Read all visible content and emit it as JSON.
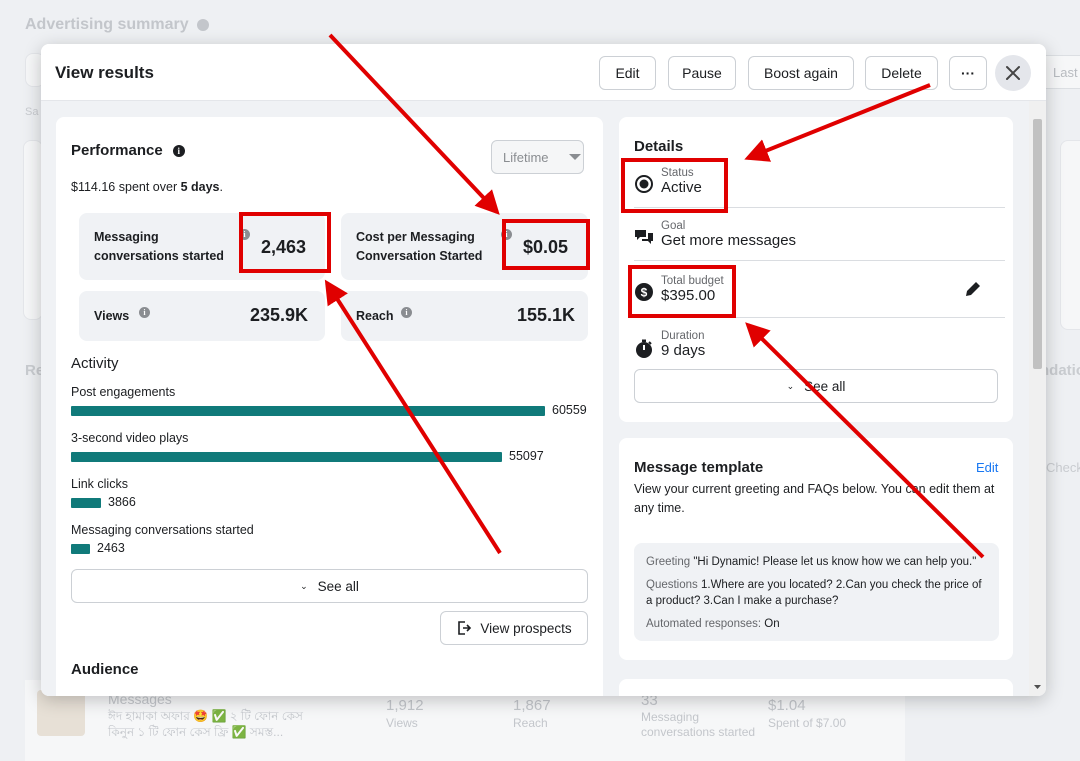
{
  "background": {
    "title": "Advertising summary",
    "last_button": "Last",
    "side_texts": [
      "Sa",
      "Re",
      "ndatio",
      "Check"
    ],
    "bottom_row": {
      "line1": "Messages",
      "line2": "ঈদ হামাকা অফার 🤩 ✅ ২ টি ফোন কেস",
      "line3": "কিনুন ১ টি ফোন কেস ফ্রি ✅ সমস্ত...",
      "views": "1,912",
      "views_label": "Views",
      "reach": "1,867",
      "reach_label": "Reach",
      "msgs": "33",
      "msgs_label": "Messaging conversations started",
      "spent": "$1.04",
      "spent_label": "Spent of $7.00"
    }
  },
  "modal": {
    "title": "View results",
    "buttons": {
      "edit": "Edit",
      "pause": "Pause",
      "boost_again": "Boost again",
      "delete": "Delete",
      "more": "···"
    }
  },
  "performance": {
    "title": "Performance",
    "period_select": "Lifetime",
    "spent_amount": "$114.16",
    "spent_mid": " spent over ",
    "spent_days": "5 days",
    "spent_end": ".",
    "metrics": {
      "msg_started_label_1": "Messaging",
      "msg_started_label_2": "conversations started",
      "msg_started_value": "2,463",
      "cost_label_1": "Cost per Messaging",
      "cost_label_2": "Conversation Started",
      "cost_value": "$0.05",
      "views_label": "Views",
      "views_value": "235.9K",
      "reach_label": "Reach",
      "reach_value": "155.1K"
    }
  },
  "activity": {
    "title": "Activity",
    "max": 60559,
    "items": [
      {
        "label": "Post engagements",
        "value": 60559,
        "display": "60559"
      },
      {
        "label": "3-second video plays",
        "value": 55097,
        "display": "55097"
      },
      {
        "label": "Link clicks",
        "value": 3866,
        "display": "3866"
      },
      {
        "label": "Messaging conversations started",
        "value": 2463,
        "display": "2463"
      }
    ],
    "see_all": "See all",
    "view_prospects": "View prospects"
  },
  "audience": {
    "title": "Audience"
  },
  "details": {
    "title": "Details",
    "status_label": "Status",
    "status_value": "Active",
    "goal_label": "Goal",
    "goal_value": "Get more messages",
    "budget_label": "Total budget",
    "budget_value": "$395.00",
    "duration_label": "Duration",
    "duration_value": "9 days",
    "see_all": "See all"
  },
  "message_template": {
    "title": "Message template",
    "edit": "Edit",
    "description": "View your current greeting and FAQs below. You can edit them at any time.",
    "greeting_label": "Greeting ",
    "greeting_text": "\"Hi Dynamic! Please let us know how we can help you.\"",
    "questions_label": "Questions ",
    "questions_text": "1.Where are you located? 2.Can you check the price of a product? 3.Can I make a purchase?",
    "auto_label": "Automated responses: ",
    "auto_value": "On"
  },
  "colors": {
    "bar": "#107a7a",
    "highlight": "#e00000",
    "link": "#1877f2"
  }
}
